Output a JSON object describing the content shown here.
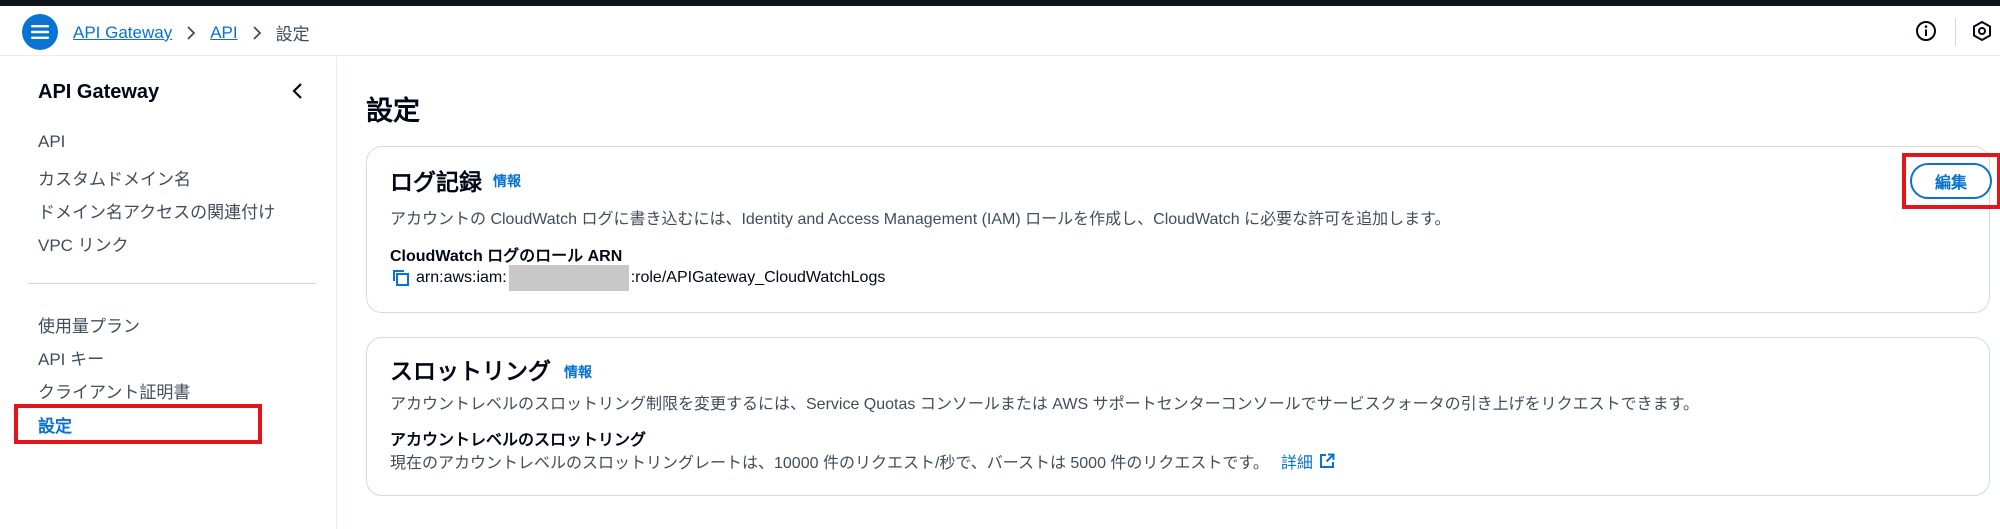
{
  "breadcrumb": {
    "items": [
      "API Gateway",
      "API"
    ],
    "current": "設定"
  },
  "sidebar": {
    "title": "API Gateway",
    "group1": [
      "API",
      "カスタムドメイン名",
      "ドメイン名アクセスの関連付け",
      "VPC リンク"
    ],
    "group2": [
      "使用量プラン",
      "API キー",
      "クライアント証明書"
    ],
    "active": "設定"
  },
  "page": {
    "title": "設定"
  },
  "logging": {
    "title": "ログ記録",
    "info": "情報",
    "edit_label": "編集",
    "description": "アカウントの CloudWatch ログに書き込むには、Identity and Access Management (IAM) ロールを作成し、CloudWatch に必要な許可を追加します。",
    "arn_label": "CloudWatch ログのロール ARN",
    "arn_prefix": "arn:aws:iam:",
    "arn_suffix": ":role/APIGateway_CloudWatchLogs"
  },
  "throttling": {
    "title": "スロットリング",
    "info": "情報",
    "description": "アカウントレベルのスロットリング制限を変更するには、Service Quotas コンソールまたは AWS サポートセンターコンソールでサービスクォータの引き上げをリクエストできます。",
    "account_label": "アカウントレベルのスロットリング",
    "account_text": "現在のアカウントレベルのスロットリングレートは、10000 件のリクエスト/秒で、バーストは 5000 件のリクエストです。",
    "detail_link": "詳細"
  },
  "colors": {
    "accent": "#0972d3",
    "highlight": "#e5141b"
  },
  "icons": {
    "menu": "menu-icon",
    "info": "info-circle-icon",
    "settings": "hexagon-settings-icon",
    "collapse": "chevron-left-icon",
    "copy": "copy-icon",
    "external": "external-link-icon"
  }
}
